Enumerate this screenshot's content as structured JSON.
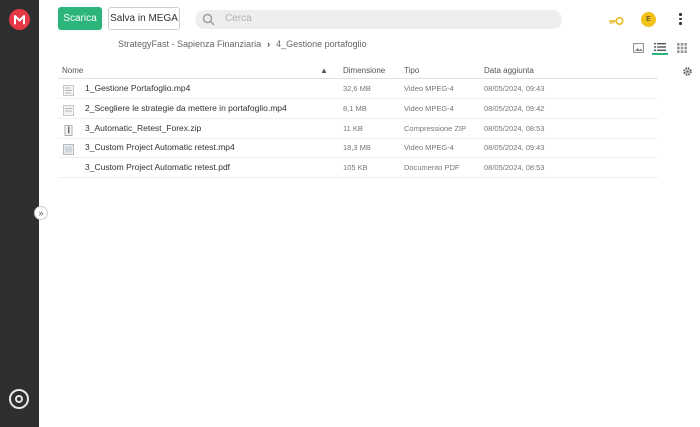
{
  "toolbar": {
    "download_label": "Scarica",
    "save_label": "Salva in MEGA"
  },
  "search": {
    "placeholder": "Cerca"
  },
  "user": {
    "initial": "E"
  },
  "breadcrumb": {
    "parent": "StrategyFast - Sapienza Finanziaria",
    "current": "4_Gestione portafoglio"
  },
  "table": {
    "headers": {
      "name": "Nome",
      "size": "Dimensione",
      "type": "Tipo",
      "date": "Data aggiunta"
    },
    "rows": [
      {
        "name": "1_Gestione Portafoglio.mp4",
        "size": "32,6 MB",
        "type": "Video MPEG-4",
        "date": "08/05/2024, 09:43"
      },
      {
        "name": "2_Scegliere le strategie da mettere in portafoglio.mp4",
        "size": "8,1 MB",
        "type": "Video MPEG-4",
        "date": "08/05/2024, 09:42"
      },
      {
        "name": "3_Automatic_Retest_Forex.zip",
        "size": "11 KB",
        "type": "Compressione ZIP",
        "date": "08/05/2024, 08:53"
      },
      {
        "name": "3_Custom Project Automatic retest.mp4",
        "size": "18,3 MB",
        "type": "Video MPEG-4",
        "date": "08/05/2024, 09:43"
      },
      {
        "name": "3_Custom Project Automatic retest.pdf",
        "size": "105 KB",
        "type": "Documento PDF",
        "date": "08/05/2024, 08:53"
      }
    ]
  },
  "colors": {
    "brand": "#e63946",
    "accent": "#2bb57a",
    "sidebar": "#2f2f2f",
    "avatar": "#f2c21b"
  },
  "icons": {
    "logo": "mega-logo-icon",
    "search": "search-icon",
    "key": "key-icon",
    "more": "kebab-menu-icon",
    "settings": "gear-icon",
    "expand": "chevron-double-right-icon"
  }
}
